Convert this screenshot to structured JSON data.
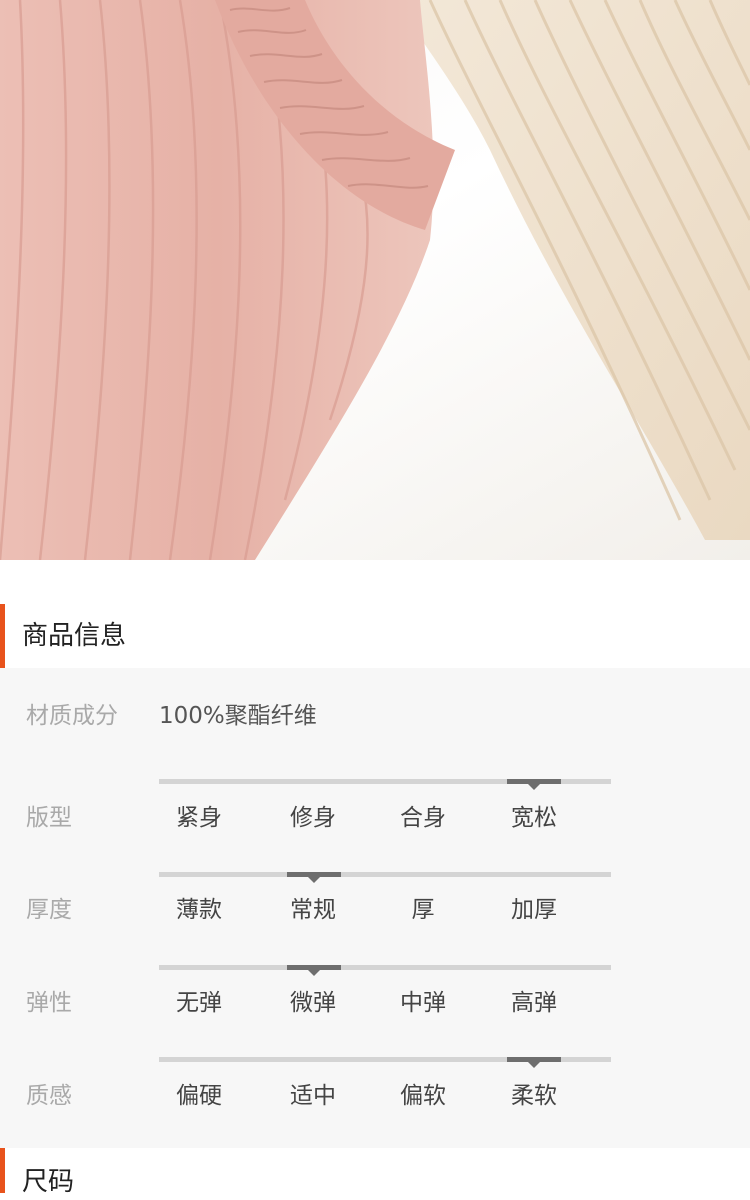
{
  "product_info": {
    "title": "商品信息",
    "material_label": "材质成分",
    "material_value": "100%聚酯纤维",
    "attributes": [
      {
        "label": "版型",
        "options": [
          "紧身",
          "修身",
          "合身",
          "宽松"
        ],
        "selected_index": 3
      },
      {
        "label": "厚度",
        "options": [
          "薄款",
          "常规",
          "厚",
          "加厚"
        ],
        "selected_index": 1
      },
      {
        "label": "弹性",
        "options": [
          "无弹",
          "微弹",
          "中弹",
          "高弹"
        ],
        "selected_index": 1
      },
      {
        "label": "质感",
        "options": [
          "偏硬",
          "适中",
          "偏软",
          "柔软"
        ],
        "selected_index": 3
      }
    ]
  },
  "size_section": {
    "title": "尺码"
  },
  "colors": {
    "accent": "#e8531c",
    "scale_track": "#d4d4d4",
    "scale_marker": "#6e6e6e",
    "panel_bg": "#f7f7f7",
    "fabric_pink": "#e9b8ae",
    "fabric_beige": "#efe2cf"
  }
}
